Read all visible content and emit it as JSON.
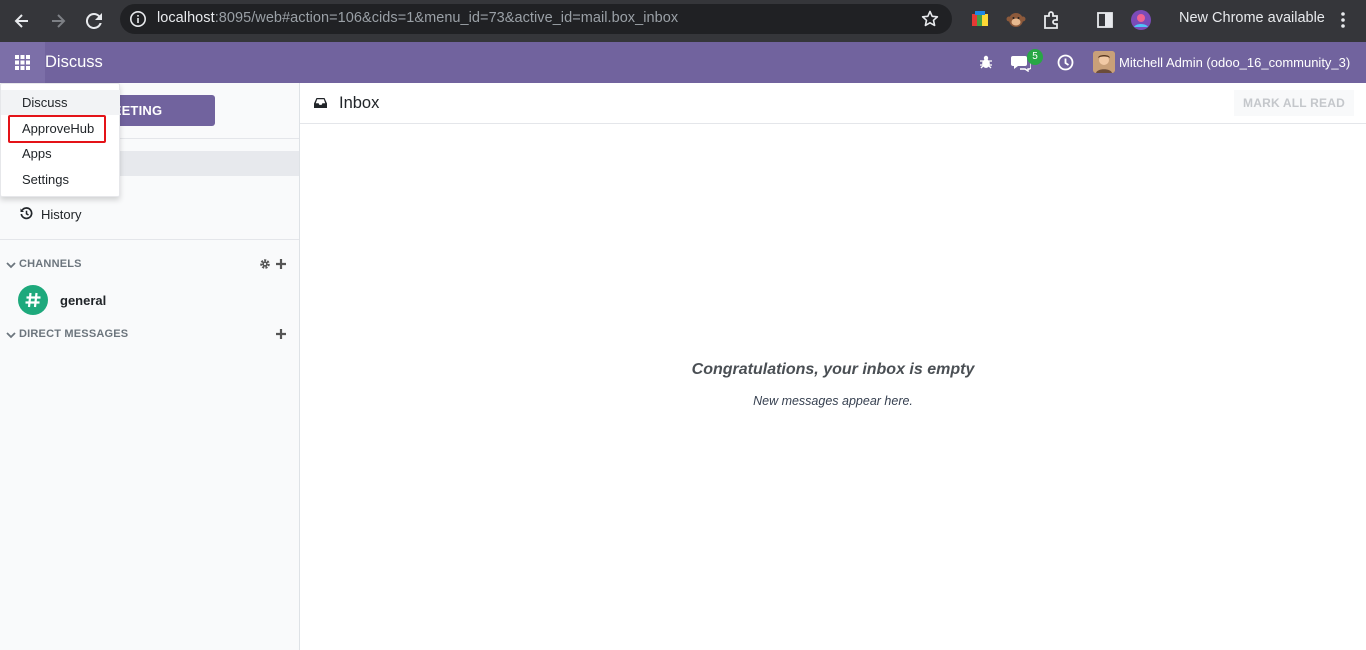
{
  "browser": {
    "url_host": "localhost",
    "url_rest": ":8095/web#action=106&cids=1&menu_id=73&active_id=mail.box_inbox",
    "update_label": "New Chrome available"
  },
  "navbar": {
    "brand": "Discuss",
    "chat_badge": "5",
    "user": "Mitchell Admin (odoo_16_community_3)",
    "accent": "#71639e"
  },
  "sidebar": {
    "meeting_button": "RT A MEETING",
    "history_label": "History",
    "channels_label": "CHANNELS",
    "channel_general": "general",
    "direct_messages_label": "DIRECT MESSAGES"
  },
  "main": {
    "title": "Inbox",
    "mark_all_read": "MARK ALL READ",
    "empty_title": "Congratulations, your inbox is empty",
    "empty_subtitle": "New messages appear here."
  },
  "app_menu": {
    "items": [
      "Discuss",
      "ApproveHub",
      "Apps",
      "Settings"
    ],
    "highlighted": "ApproveHub",
    "highlight_color": "#e41318"
  }
}
